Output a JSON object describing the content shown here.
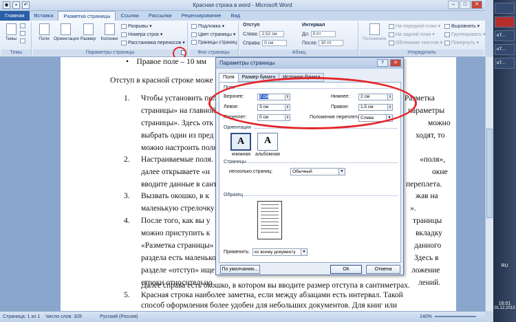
{
  "window": {
    "title": "Красная строка в word - Microsoft Word"
  },
  "tabs": [
    "Главная",
    "Вставка",
    "Разметка страницы",
    "Ссылки",
    "Рассылки",
    "Рецензирование",
    "Вид"
  ],
  "ribbon": {
    "themes": {
      "btn": "Темы",
      "label": "Темы"
    },
    "page_setup": {
      "fields": "Поля",
      "orientation": "Ориентация",
      "size": "Размер",
      "columns": "Колонки",
      "breaks": "Разрывы",
      "line_numbers": "Номера строк",
      "hyphenation": "Расстановка переносов",
      "label": "Параметры страницы"
    },
    "background": {
      "watermark": "Подложка",
      "page_color": "Цвет страницы",
      "page_borders": "Границы страниц",
      "label": "Фон страницы"
    },
    "paragraph": {
      "indent": "Отступ",
      "left": "Слева:",
      "left_val": "2,52 см",
      "right": "Справа:",
      "right_val": "0 см",
      "spacing": "Интервал",
      "before": "До:",
      "before_val": "0 пт",
      "after": "После:",
      "after_val": "10 пт",
      "label": "Абзац"
    },
    "arrange": {
      "position": "Положение",
      "front": "На передний план",
      "back": "На задний план",
      "wrap": "Обтекание текстом",
      "align": "Выровнять",
      "group": "Группировать",
      "rotate": "Повернуть",
      "label": "Упорядочить"
    }
  },
  "doc": {
    "line0": "Правое поле – 10 мм",
    "line1": "Отступ в красной строке може",
    "items": [
      {
        "n": "1.",
        "lines": [
          "Чтобы установить поля",
          "страницы» на главной",
          "страницы». Здесь отк",
          "выбрать один из пред",
          "можно настроить поля"
        ]
      },
      {
        "n": "2.",
        "lines": [
          "Настраиваемые поля.",
          "далее открываете «н",
          "вводите данные в сант"
        ]
      },
      {
        "n": "3.",
        "lines": [
          "Вызвать окошко, в к",
          "маленькую стрелочку в"
        ]
      },
      {
        "n": "4.",
        "lines": [
          "После того, как вы у",
          "можно приступить к",
          "«Разметка страницы»",
          "раздела есть маленько",
          "разделе «отступ» ище",
          "строки относительно",
          "Далее справа есть окошко, в котором вы вводите размер отступа в сантиметрах."
        ]
      },
      {
        "n": "5.",
        "lines": [
          "Красная строка наиболее заметна, если между абзацами есть интервал.  Такой",
          "способ оформления более удобен для небольших документов. Для книг или"
        ]
      }
    ],
    "right_frag": [
      "Разметка",
      "параметры",
      "можно",
      "ходят, то",
      "«поля»,",
      "окне",
      "переплета.",
      "жав на",
      "».",
      "траницы",
      "вкладку",
      "данного",
      "Здесь в",
      "ложение",
      "лений."
    ]
  },
  "status": {
    "page": "Страница: 1 из 1",
    "words": "Число слов: 328",
    "lang": "Русский (Россия)",
    "zoom": "140%"
  },
  "taskbar": {
    "items": [
      "",
      "",
      "eT...",
      "eT...",
      "eT..."
    ],
    "lang": "RU",
    "time": "16:01",
    "date": "01.12.2013"
  },
  "dialog": {
    "title": "Параметры страницы",
    "tabs": [
      "Поля",
      "Размер бумаги",
      "Источник бумаги"
    ],
    "margins_section": "Поля",
    "top_label": "Верхнее:",
    "top_val": "2 см",
    "bottom_label": "Нижнее:",
    "bottom_val": "2 см",
    "left_label": "Левое:",
    "left_val": "3 см",
    "right_label": "Правое:",
    "right_val": "1,5 см",
    "gutter_label": "Переплет:",
    "gutter_val": "0 см",
    "gutter_pos_label": "Положение переплета:",
    "gutter_pos_val": "Слева",
    "orientation_section": "Ориентация",
    "portrait": "книжная",
    "landscape": "альбомная",
    "pages_section": "Страницы",
    "multiple_label": "несколько страниц:",
    "multiple_val": "Обычный",
    "preview_section": "Образец",
    "apply_label": "Применить:",
    "apply_val": "ко всему документу",
    "default_btn": "По умолчанию...",
    "ok_btn": "ОК",
    "cancel_btn": "Отмена"
  }
}
